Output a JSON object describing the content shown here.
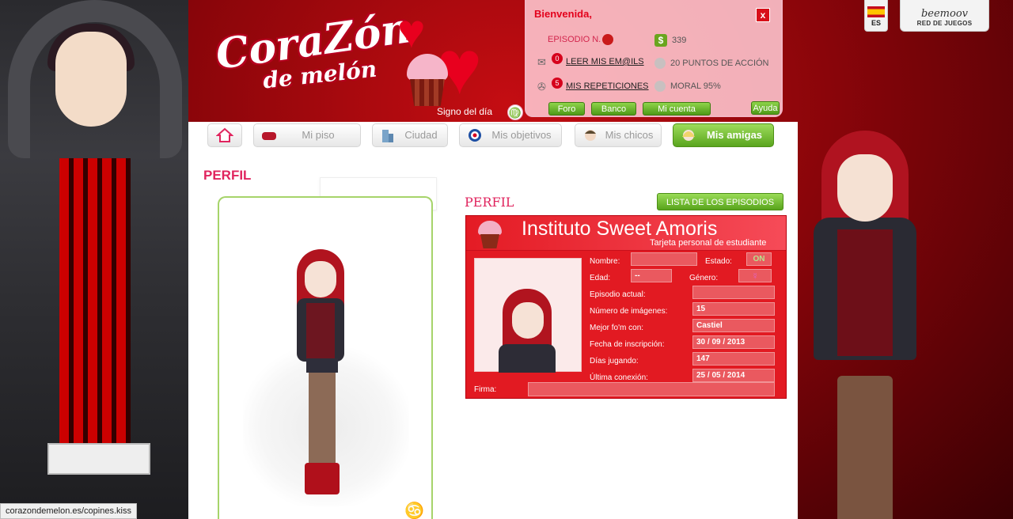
{
  "logo": {
    "title": "CoraZón",
    "subtitle": "de melón"
  },
  "signo": {
    "label": "Signo del día",
    "glyph": "♍"
  },
  "panel": {
    "welcome": "Bienvenida,",
    "close": "x",
    "episode_label": "EPISODIO N.",
    "money": "339",
    "mail_count": "0",
    "mail_link": "LEER MIS EM@ILS",
    "action_points": "20 PUNTOS DE ACCIÓN",
    "reps_count": "5",
    "reps_link": "MIS REPETICIONES",
    "moral": "MORAL 95%",
    "buttons": [
      "Foro",
      "Banco",
      "Mi cuenta",
      "Ayuda"
    ]
  },
  "lang": {
    "code": "ES"
  },
  "beemoov": {
    "logo": "beemoov",
    "sub": "RED DE JUEGOS"
  },
  "nav": {
    "items": [
      {
        "label": ""
      },
      {
        "label": "Mi piso"
      },
      {
        "label": "Ciudad"
      },
      {
        "label": "Mis objetivos"
      },
      {
        "label": "Mis chicos"
      },
      {
        "label": "Mis amigas"
      }
    ]
  },
  "page": {
    "heading": "PERFIL",
    "heading2": "PERFIL",
    "episodes_button": "LISTA DE LOS EPISODIOS",
    "zodiac": "♋"
  },
  "card": {
    "title": "Instituto Sweet Amoris",
    "subtitle": "Tarjeta personal de estudiante",
    "fields": {
      "name_label": "Nombre:",
      "name_value": "",
      "state_label": "Estado:",
      "state_value": "ON",
      "age_label": "Edad:",
      "age_value": "--",
      "gender_label": "Género:",
      "gender_value": "☿",
      "episode_label": "Episodio actual:",
      "episode_value": "",
      "images_label": "Número de imágenes:",
      "images_value": "15",
      "best_label": "Mejor fo'm con:",
      "best_value": "Castiel",
      "signup_label": "Fecha de inscripción:",
      "signup_value": "30 / 09 / 2013",
      "days_label": "Días jugando:",
      "days_value": "147",
      "last_label": "Última conexión:",
      "last_value": "25 / 05 / 2014"
    },
    "firma_label": "Firma:"
  },
  "status_url": "corazondemelon.es/copines.kiss",
  "colors": {
    "brand_red": "#e21a22",
    "accent_pink": "#e0245e",
    "green": "#5aa51e"
  }
}
